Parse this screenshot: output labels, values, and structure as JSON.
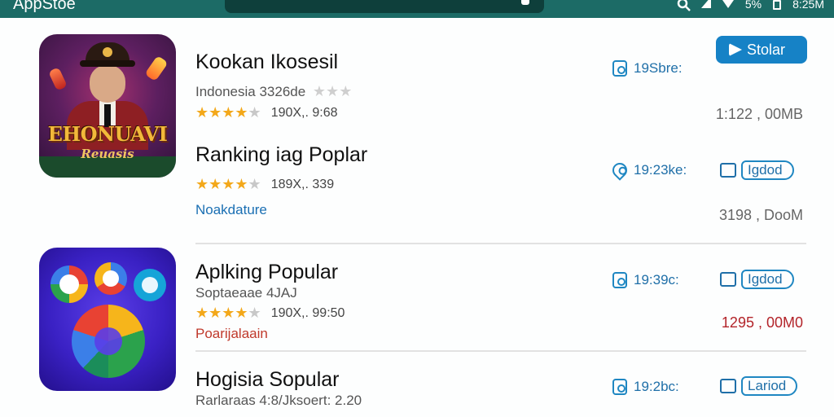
{
  "topbar": {
    "title": "AppStoe",
    "status": {
      "signal": "⁴",
      "battery_text": "5%",
      "time": "8:25M"
    }
  },
  "apps": [
    {
      "icon_text": "EHONUAVI",
      "icon_subtext": "Reuasis",
      "title": "Kookan Ikosesil",
      "subtitle": "Indonesia 3326de",
      "rating_text": "190X,. 9:68",
      "meta": "19Sbre:",
      "button": "Stolar",
      "size": "1:122 , 00MB"
    },
    {
      "title": "Ranking iag  Poplar",
      "rating_text": "189X,. 339",
      "link": "Noakdature",
      "meta": "19:23ke:",
      "button": "Igdod",
      "size": "3198 , DooM"
    },
    {
      "title": "Aplking Popular",
      "subtitle": "Soptaeaae 4JAJ",
      "rating_text": "190X,. 99:50",
      "link": "Poarijalaain",
      "meta": "19:39c:",
      "button": "Igdod",
      "size": "1295 , 00M0"
    },
    {
      "title": "Hogisia Sopular",
      "subtitle": "Rarlaraas 4:8/Jksoert: 2.20",
      "meta": "19:2bc:",
      "button": "Lariod"
    }
  ],
  "colors": {
    "topbar": "#1c6b66",
    "accent": "#1682c6",
    "star": "#f3a81a"
  }
}
